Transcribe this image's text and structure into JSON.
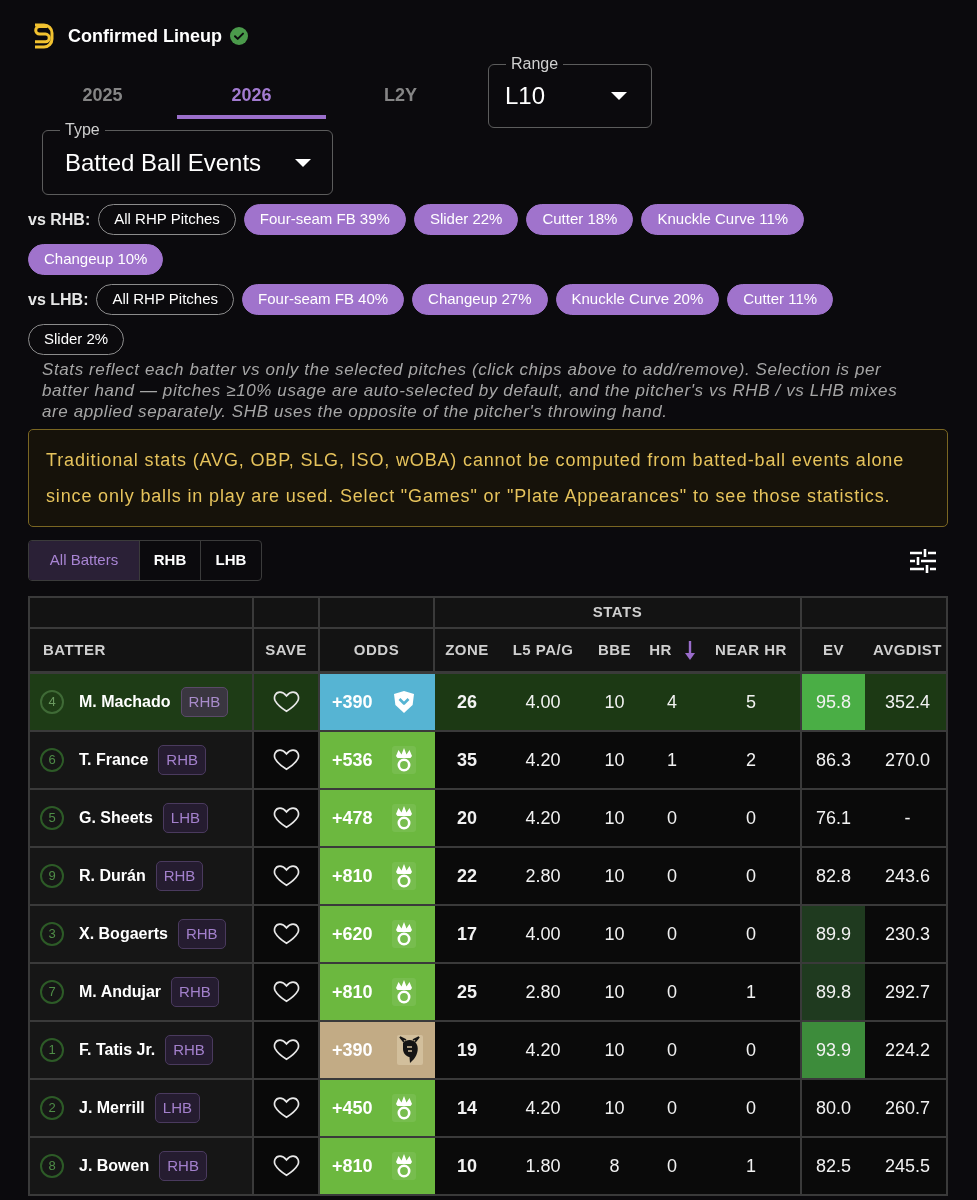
{
  "header": {
    "title": "Confirmed Lineup",
    "verified": true
  },
  "tabs": [
    {
      "label": "2025",
      "selected": false
    },
    {
      "label": "2026",
      "selected": true
    },
    {
      "label": "L2Y",
      "selected": false
    }
  ],
  "range_select": {
    "label": "Range",
    "value": "L10"
  },
  "type_select": {
    "label": "Type",
    "value": "Batted Ball Events"
  },
  "pitch_filters": [
    {
      "label": "vs RHB:",
      "chips": [
        {
          "label": "All RHP Pitches",
          "selected": false
        },
        {
          "label": "Four-seam FB 39%",
          "selected": true
        },
        {
          "label": "Slider 22%",
          "selected": true
        },
        {
          "label": "Cutter 18%",
          "selected": true
        },
        {
          "label": "Knuckle Curve 11%",
          "selected": true
        },
        {
          "label": "Changeup 10%",
          "selected": true
        }
      ]
    },
    {
      "label": "vs LHB:",
      "chips": [
        {
          "label": "All RHP Pitches",
          "selected": false
        },
        {
          "label": "Four-seam FB 40%",
          "selected": true
        },
        {
          "label": "Changeup 27%",
          "selected": true
        },
        {
          "label": "Knuckle Curve 20%",
          "selected": true
        },
        {
          "label": "Cutter 11%",
          "selected": true
        },
        {
          "label": "Slider 2%",
          "selected": false
        }
      ]
    }
  ],
  "note": "Stats reflect each batter vs only the selected pitches (click chips above to add/remove). Selection is per batter hand — pitches ≥10% usage are auto-selected by default, and the pitcher's vs RHB / vs LHB mixes are applied separately. SHB uses the opposite of the pitcher's throwing hand.",
  "warning": "Traditional stats (AVG, OBP, SLG, ISO, wOBA) cannot be computed from batted-ball events alone since only balls in play are used. Select \"Games\" or \"Plate Appearances\" to see those statistics.",
  "batter_filter": [
    {
      "label": "All Batters",
      "selected": true
    },
    {
      "label": "RHB",
      "selected": false
    },
    {
      "label": "LHB",
      "selected": false
    }
  ],
  "table": {
    "group_header": "STATS",
    "columns": [
      {
        "label": "BATTER",
        "sorted": false
      },
      {
        "label": "SAVE",
        "sorted": false
      },
      {
        "label": "ODDS",
        "sorted": false
      },
      {
        "label": "ZONE",
        "sorted": false
      },
      {
        "label": "L5 PA/G",
        "sorted": false
      },
      {
        "label": "BBE",
        "sorted": false
      },
      {
        "label": "HR",
        "sorted": true,
        "descending": true
      },
      {
        "label": "NEAR HR",
        "sorted": false
      },
      {
        "label": "EV",
        "sorted": false
      },
      {
        "label": "AVGDIST",
        "sorted": false
      }
    ],
    "rows": [
      {
        "order": "4",
        "name": "M. Machado",
        "hand": "RHB",
        "highlighted": true,
        "saved": false,
        "odds": {
          "value": "+390",
          "kind": "shield",
          "color": "#56b4d3"
        },
        "zone": "26",
        "l5_pa_g": "4.00",
        "bbe": "10",
        "hr": "4",
        "near_hr": "5",
        "ev": {
          "value": "95.8",
          "color": "#4aae45"
        },
        "avg_dist": "352.4"
      },
      {
        "order": "6",
        "name": "T. France",
        "hand": "RHB",
        "highlighted": false,
        "saved": false,
        "odds": {
          "value": "+536",
          "kind": "crown",
          "color": "#6cb83f"
        },
        "zone": "35",
        "l5_pa_g": "4.20",
        "bbe": "10",
        "hr": "1",
        "near_hr": "2",
        "ev": {
          "value": "86.3"
        },
        "avg_dist": "270.0"
      },
      {
        "order": "5",
        "name": "G. Sheets",
        "hand": "LHB",
        "highlighted": false,
        "saved": false,
        "odds": {
          "value": "+478",
          "kind": "crown",
          "color": "#6cb83f"
        },
        "zone": "20",
        "l5_pa_g": "4.20",
        "bbe": "10",
        "hr": "0",
        "near_hr": "0",
        "ev": {
          "value": "76.1"
        },
        "avg_dist": "-"
      },
      {
        "order": "9",
        "name": "R. Durán",
        "hand": "RHB",
        "highlighted": false,
        "saved": false,
        "odds": {
          "value": "+810",
          "kind": "crown",
          "color": "#6cb83f"
        },
        "zone": "22",
        "l5_pa_g": "2.80",
        "bbe": "10",
        "hr": "0",
        "near_hr": "0",
        "ev": {
          "value": "82.8"
        },
        "avg_dist": "243.6"
      },
      {
        "order": "3",
        "name": "X. Bogaerts",
        "hand": "RHB",
        "highlighted": false,
        "saved": false,
        "odds": {
          "value": "+620",
          "kind": "crown",
          "color": "#6cb83f"
        },
        "zone": "17",
        "l5_pa_g": "4.00",
        "bbe": "10",
        "hr": "0",
        "near_hr": "0",
        "ev": {
          "value": "89.9",
          "color": "#1f3a1f"
        },
        "avg_dist": "230.3"
      },
      {
        "order": "7",
        "name": "M. Andujar",
        "hand": "RHB",
        "highlighted": false,
        "saved": false,
        "odds": {
          "value": "+810",
          "kind": "crown",
          "color": "#6cb83f"
        },
        "zone": "25",
        "l5_pa_g": "2.80",
        "bbe": "10",
        "hr": "0",
        "near_hr": "1",
        "ev": {
          "value": "89.8",
          "color": "#1f3a1f"
        },
        "avg_dist": "292.7"
      },
      {
        "order": "1",
        "name": "F. Tatis Jr.",
        "hand": "RHB",
        "highlighted": false,
        "saved": false,
        "odds": {
          "value": "+390",
          "kind": "creature",
          "color": "#c2ab85"
        },
        "zone": "19",
        "l5_pa_g": "4.20",
        "bbe": "10",
        "hr": "0",
        "near_hr": "0",
        "ev": {
          "value": "93.9",
          "color": "#3d8c3b"
        },
        "avg_dist": "224.2"
      },
      {
        "order": "2",
        "name": "J. Merrill",
        "hand": "LHB",
        "highlighted": false,
        "saved": false,
        "odds": {
          "value": "+450",
          "kind": "crown",
          "color": "#6cb83f"
        },
        "zone": "14",
        "l5_pa_g": "4.20",
        "bbe": "10",
        "hr": "0",
        "near_hr": "0",
        "ev": {
          "value": "80.0"
        },
        "avg_dist": "260.7"
      },
      {
        "order": "8",
        "name": "J. Bowen",
        "hand": "RHB",
        "highlighted": false,
        "saved": false,
        "odds": {
          "value": "+810",
          "kind": "crown",
          "color": "#6cb83f"
        },
        "zone": "10",
        "l5_pa_g": "1.80",
        "bbe": "8",
        "hr": "0",
        "near_hr": "1",
        "ev": {
          "value": "82.5"
        },
        "avg_dist": "245.5"
      }
    ]
  }
}
